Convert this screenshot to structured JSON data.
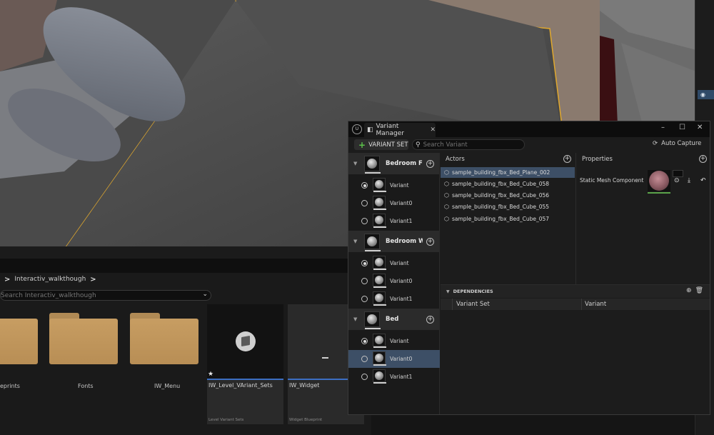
{
  "content_browser": {
    "breadcrumb": {
      "sep1": ">",
      "folder": "Interactiv_walkthough",
      "sep2": ">"
    },
    "search_placeholder": "Search Interactiv_walkthough",
    "folders": [
      {
        "label": "eprints"
      },
      {
        "label": "Fonts"
      },
      {
        "label": "IW_Menu"
      }
    ],
    "assets": [
      {
        "name": "IW_Level_VAriant_Sets",
        "type": "Level Variant Sets",
        "icon": "level-variant-sets-icon"
      },
      {
        "name": "IW_Widget",
        "type": "Widget Blueprint",
        "icon": "widget-blueprint-icon"
      }
    ]
  },
  "variant_manager": {
    "tab_title": "Variant Manager",
    "add_variant_set_label": "VARIANT SET",
    "search_placeholder": "Search Variant",
    "auto_capture_label": "Auto Capture",
    "variant_sets": [
      {
        "name": "Bedroom Floor",
        "variants": [
          {
            "label": "Variant",
            "active": true
          },
          {
            "label": "Variant0",
            "active": false
          },
          {
            "label": "Variant1",
            "active": false
          }
        ]
      },
      {
        "name": "Bedroom Walls",
        "variants": [
          {
            "label": "Variant",
            "active": true
          },
          {
            "label": "Variant0",
            "active": false
          },
          {
            "label": "Variant1",
            "active": false
          }
        ]
      },
      {
        "name": "Bed",
        "variants": [
          {
            "label": "Variant",
            "active": true
          },
          {
            "label": "Variant0",
            "active": false,
            "selected": true
          },
          {
            "label": "Variant1",
            "active": false
          }
        ]
      }
    ],
    "actors_header": "Actors",
    "actors": [
      "sample_building_fbx_Bed_Plane_002",
      "sample_building_fbx_Bed_Cube_058",
      "sample_building_fbx_Bed_Cube_056",
      "sample_building_fbx_Bed_Cube_055",
      "sample_building_fbx_Bed_Cube_057"
    ],
    "properties_header": "Properties",
    "property_label": "Static Mesh Component / Material",
    "dependencies_header": "DEPENDENCIES",
    "dependencies_columns": [
      "Variant Set",
      "Variant"
    ]
  },
  "colors": {
    "selection": "#3d4f66",
    "accent_blue": "#3c6ec2",
    "add_green": "#5cc24a",
    "folder": "#c79d62",
    "highlight_outline": "#e0a82e"
  }
}
